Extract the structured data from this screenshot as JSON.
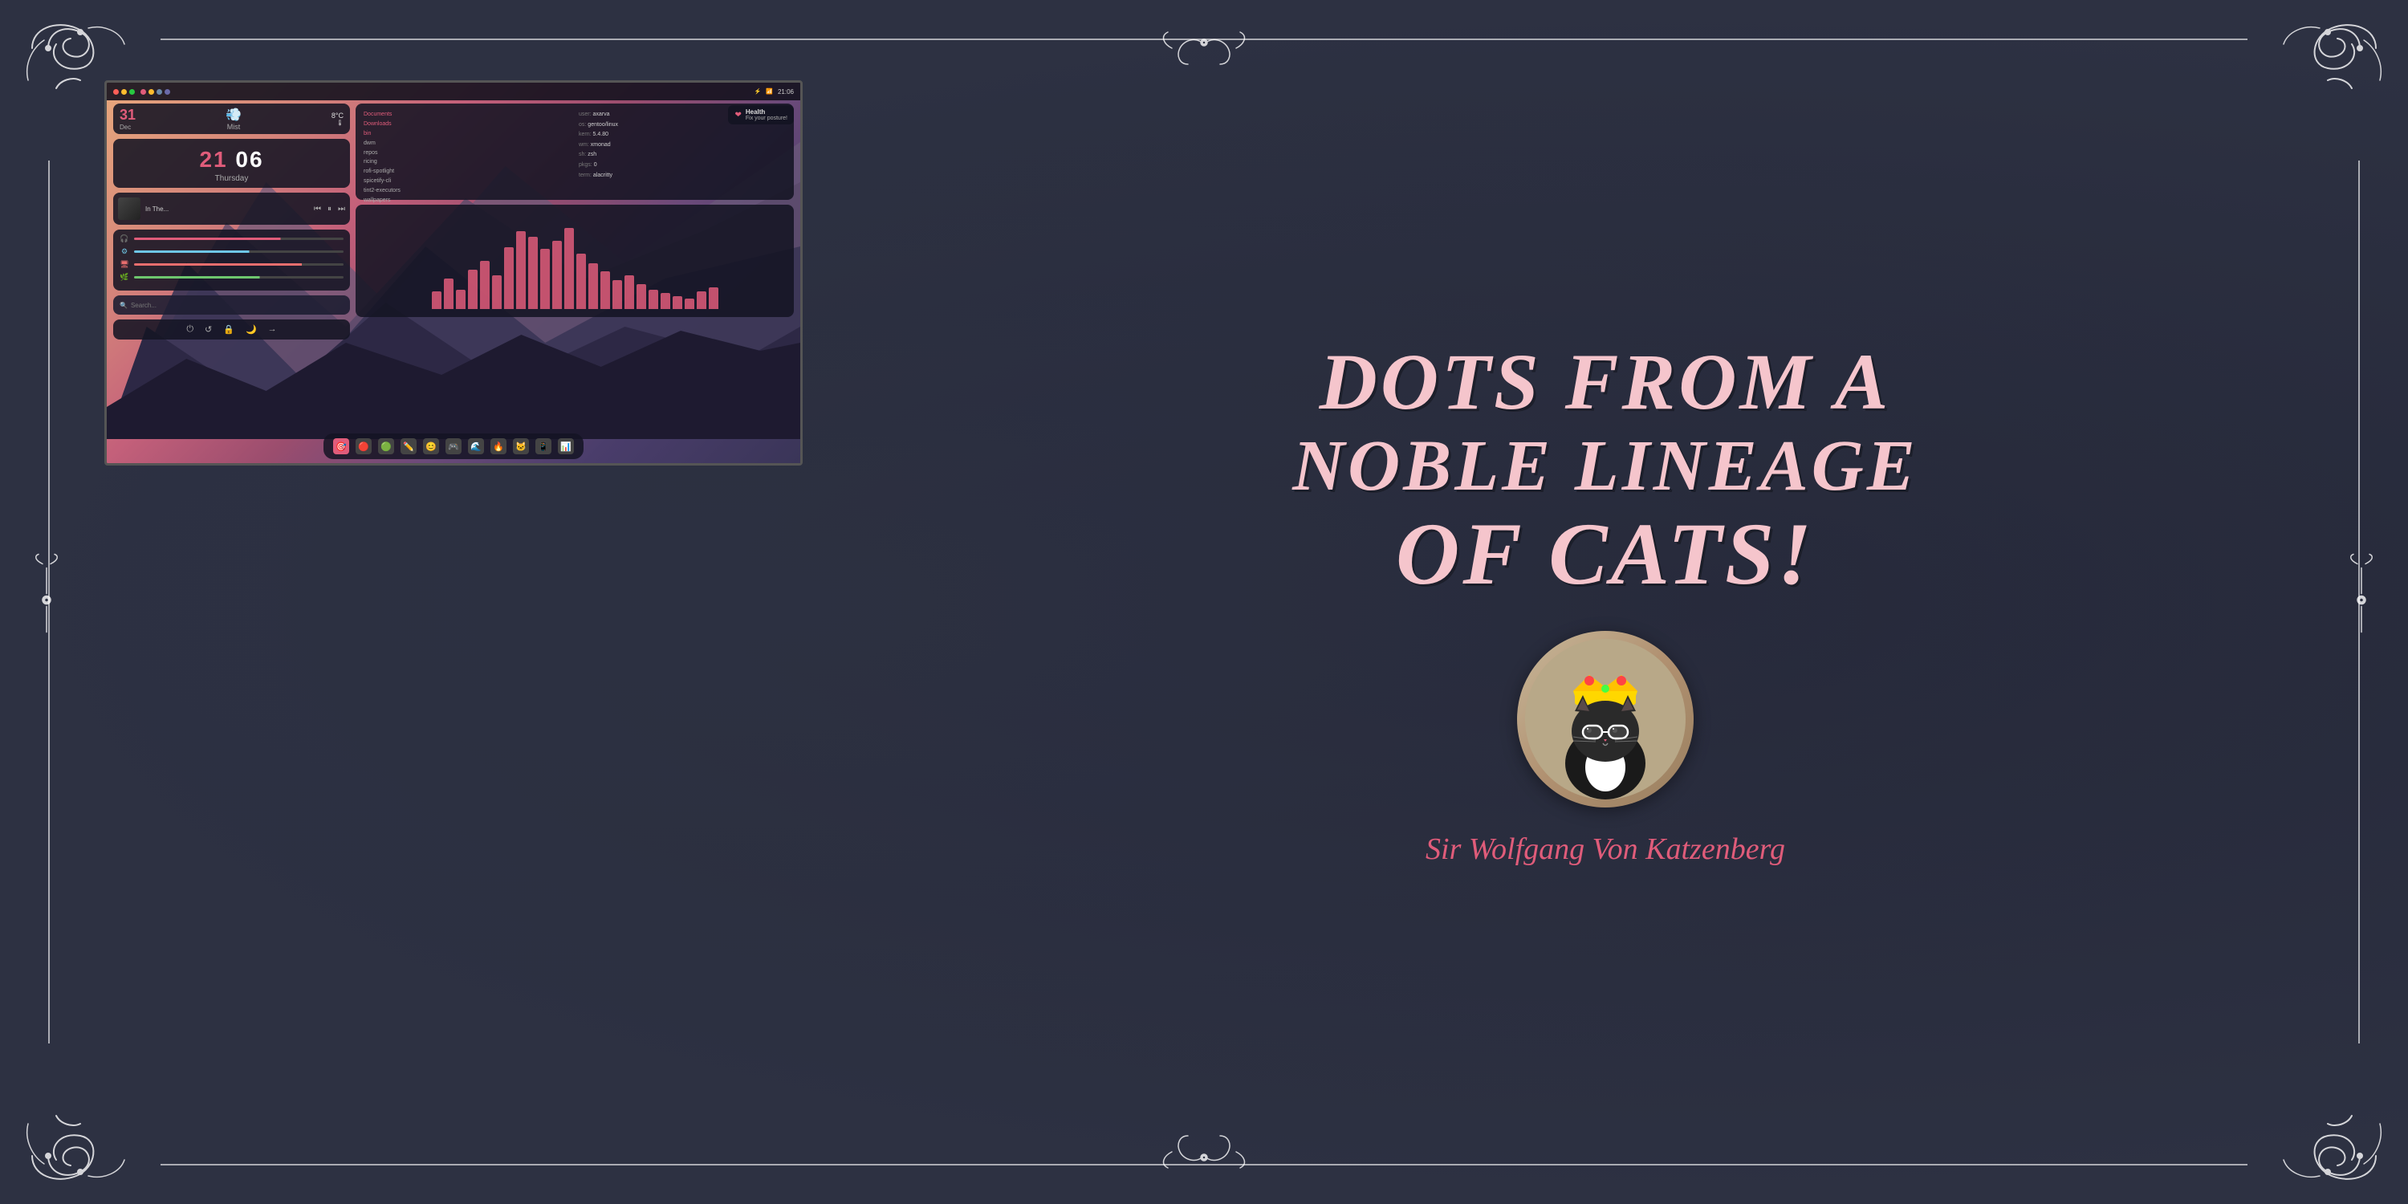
{
  "page": {
    "bg_color": "#2d3142"
  },
  "decorations": {
    "corner_swirl": "decorative swirl ornament"
  },
  "title": {
    "line1": "Dots from a",
    "line2": "Noble Lineage",
    "line3": "of Cats!"
  },
  "subtitle": "Sir Wolfgang Von Katzenberg",
  "desktop": {
    "topbar": {
      "dots": [
        "#ff5f57",
        "#febc2e",
        "#28c840",
        "#red",
        "#yellow",
        "#green",
        "#purple"
      ],
      "time": "21:06",
      "battery_icon": "⚡"
    },
    "weather": {
      "date": "31",
      "month": "Dec",
      "wind_icon": "💨",
      "temp": "8°C",
      "condition": "Mist"
    },
    "clock": {
      "hours": "21",
      "minutes": "06",
      "day": "Thursday"
    },
    "music": {
      "title": "In The...",
      "prev": "⏮",
      "pause": "⏸",
      "next": "⏭"
    },
    "sliders": [
      {
        "icon": "🎧",
        "color": "#e05c7a",
        "value": 70
      },
      {
        "icon": "⚙",
        "color": "#6ec6e6",
        "value": 55
      },
      {
        "icon": "🖥",
        "color": "#e86e6e",
        "value": 80
      },
      {
        "icon": "🌿",
        "color": "#6ec66e",
        "value": 60
      }
    ],
    "search": {
      "placeholder": "🔍 Search..."
    },
    "sys_buttons": [
      "⏻",
      "↺",
      "🔒",
      "🌙",
      "→"
    ],
    "files": [
      "Documents",
      "Downloads",
      "bin",
      "dwm",
      "repos",
      "ricing",
      "rofi-spotlight",
      "spicetify-cli",
      "tint2-executors",
      "wallpapers"
    ],
    "sysinfo": {
      "user": "axarva",
      "os": "gentoo/linux",
      "kern": "5.4.80",
      "wm": "xmonad",
      "sh": "zsh",
      "pkgs": "0",
      "term": "alacritty"
    },
    "visualizer_bars": [
      20,
      35,
      25,
      45,
      60,
      40,
      75,
      90,
      85,
      70,
      80,
      95,
      65,
      55,
      45,
      35,
      40,
      30,
      25,
      20,
      18,
      15,
      22,
      28
    ],
    "health": {
      "title": "Health",
      "message": "Fix your posture!"
    },
    "dock_icons": [
      "🎯",
      "🔴",
      "🟢",
      "✏️",
      "😊",
      "🎮",
      "🌊",
      "🔥",
      "🐱",
      "📱",
      "📊"
    ]
  },
  "cat_avatar": {
    "emoji": "🐱",
    "description": "A noble cat with crown and glasses"
  }
}
